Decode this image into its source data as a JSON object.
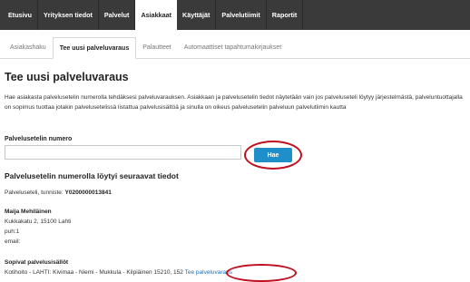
{
  "topnav": {
    "items": [
      "Etusivu",
      "Yrityksen tiedot",
      "Palvelut",
      "Asiakkaat",
      "Käyttäjät",
      "Palvelutiimit",
      "Raportit"
    ],
    "active_index": 3
  },
  "subnav": {
    "tabs": [
      "Asiakashaku",
      "Tee uusi palveluvaraus",
      "Palautteet",
      "Automaattiset tapahtumakirjaukset"
    ],
    "active_index": 1
  },
  "page": {
    "title": "Tee uusi palveluvaraus",
    "intro": "Hae asiakasta palvelusetelin numerolla tehdäksesi palveluvarauksen. Asiakkaan ja palvelusetelin tiedot näytetään vain jos palveluseteli löytyy järjestelmästä, palveluntuottajalla on sopimus tuottaa jotakin palvelusetelissä listattua palvelusisältöä ja sinulla on oikeus palvelusetelin palveluun palvelutiimin kautta"
  },
  "search": {
    "label": "Palvelusetelin numero",
    "value": "",
    "placeholder": "",
    "button_label": "Hae"
  },
  "results": {
    "heading": "Palvelusetelin numerolla löytyi seuraavat tiedot",
    "voucher_prefix": "Palveluseteli, tunniste:",
    "voucher_id": "Y0200000013841",
    "customer_name": "Maija Mehiläinen",
    "address": "Kukkakatu 2, 15100 Lahti",
    "phone": "puh:1",
    "email": "email:",
    "contents_heading": "Sopivat palvelusisällöt",
    "contents_text": "Kotihoito - LAHTI: Kivimaa - Niemi - Mukkula - Kilpiäinen 15210, 152",
    "contents_link": "Tee palveluvaraus"
  },
  "colors": {
    "topnav_bg": "#3a3a3a",
    "button_bg": "#1f8fc9",
    "highlight_circle": "#c01020",
    "link": "#1f6fb5"
  }
}
